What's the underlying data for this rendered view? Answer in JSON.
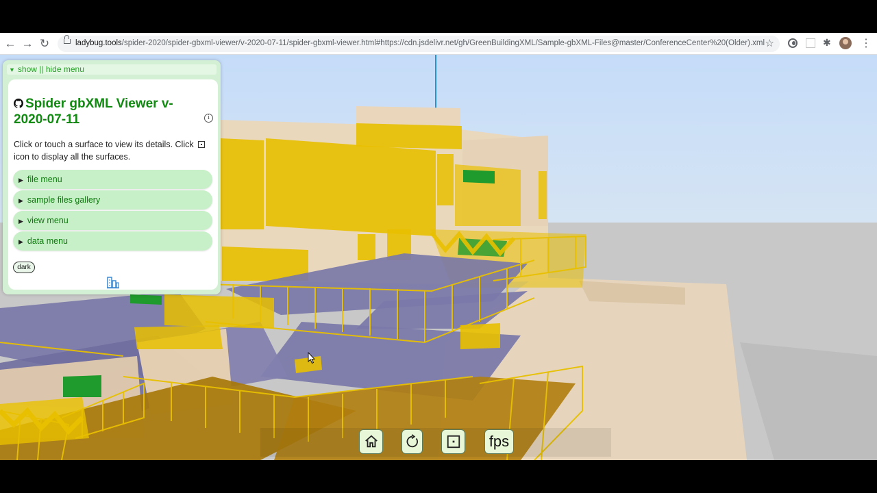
{
  "browser": {
    "url_domain": "ladybug.tools",
    "url_path": "/spider-2020/spider-gbxml-viewer/v-2020-07-11/spider-gbxml-viewer.html#https://cdn.jsdelivr.net/gh/GreenBuildingXML/Sample-gbXML-Files@master/ConferenceCenter%20(Older).xml",
    "back_icon": "←",
    "forward_icon": "→",
    "reload_icon": "↻",
    "star_icon": "☆",
    "menu_icon": "⋮",
    "extensions_icon": "✱"
  },
  "menu": {
    "toggle_label": "show || hide menu",
    "toggle_icon": "▼",
    "title": "Spider gbXML Viewer v-2020-07-11",
    "info_icon": "i",
    "description_start": "Click or touch a surface to view its details. Click",
    "description_end": "icon to display all the surfaces.",
    "items": [
      {
        "label": "file menu"
      },
      {
        "label": "sample files gallery"
      },
      {
        "label": "view menu"
      },
      {
        "label": "data menu"
      }
    ],
    "item_icon": "▶",
    "dark_label": "dark"
  },
  "controls": {
    "fps_label": "fps"
  },
  "colors": {
    "accent_green": "#118a11",
    "menu_bg": "#d4f0d4",
    "details_bg": "#c8f0c8",
    "surface_yellow": "#e8c000",
    "surface_violet": "#7a78a8",
    "surface_green": "#1f9a2c",
    "shadow_brown": "#a8780a"
  }
}
